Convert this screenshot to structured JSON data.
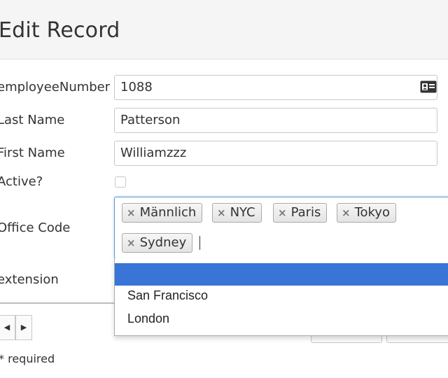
{
  "header": {
    "title": "Edit Record"
  },
  "form": {
    "employee_number": {
      "label": "employeeNumber",
      "value": "1088",
      "icon": "id-card-icon"
    },
    "last_name": {
      "label": "Last Name",
      "value": "Patterson"
    },
    "first_name": {
      "label": "First Name",
      "value": "Williamzzz"
    },
    "active": {
      "label": "Active?",
      "checked": false
    },
    "office_code": {
      "label": "Office Code",
      "tags": [
        {
          "remove": "×",
          "label": "Männlich"
        },
        {
          "remove": "×",
          "label": "NYC"
        },
        {
          "remove": "×",
          "label": "Paris"
        },
        {
          "remove": "×",
          "label": "Tokyo"
        },
        {
          "remove": "×",
          "label": "Sydney"
        }
      ],
      "options": [
        "",
        "San Francisco",
        "London"
      ]
    },
    "extension": {
      "label": "extension"
    }
  },
  "pager": {
    "prev": "◀",
    "next": "▶"
  },
  "footer": {
    "required_note": "* required"
  },
  "colors": {
    "highlight": "#3875d7",
    "focus_border": "#5b9bd5",
    "header_bg": "#f5f5f5"
  }
}
